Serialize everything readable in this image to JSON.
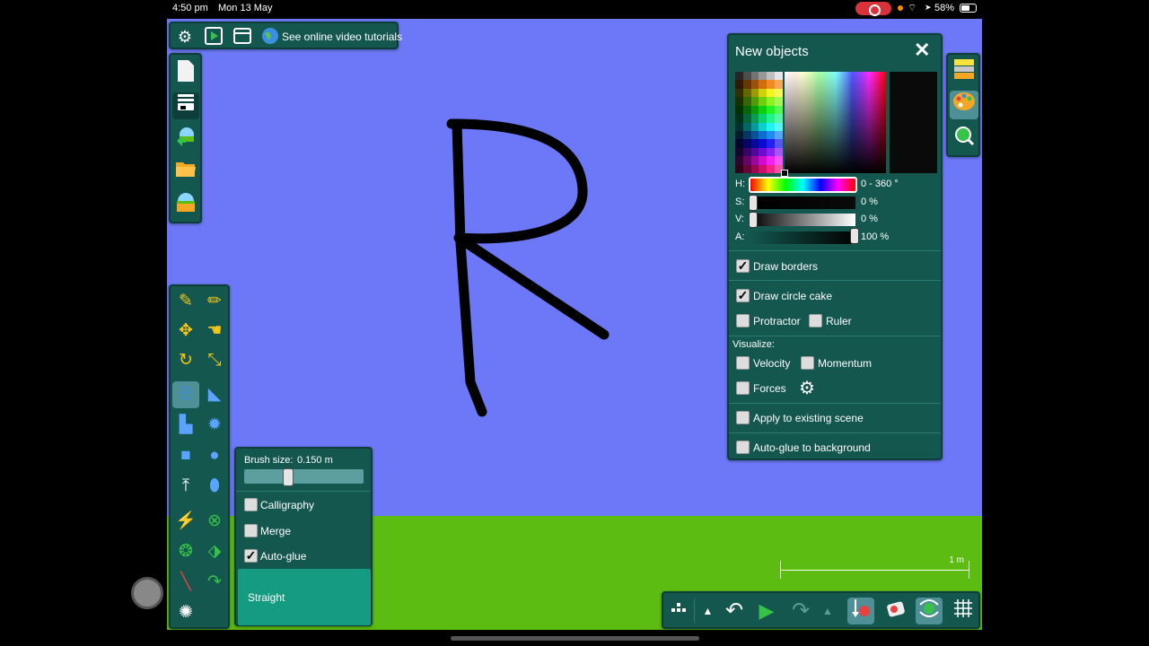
{
  "status": {
    "time": "4:50 pm",
    "date": "Mon 13 May",
    "battery": "58%"
  },
  "topbar": {
    "settings_icon": "gear-icon",
    "play_icon": "play-icon",
    "window_icon": "window-icon",
    "globe_icon": "globe-icon",
    "tutorials_label": "See online video tutorials"
  },
  "lefttop": {
    "items": [
      "new-document-icon",
      "layers-icon",
      "download-scene-icon",
      "open-folder-icon",
      "scene-browser-icon"
    ]
  },
  "lefttools": {
    "tools": [
      "sketch",
      "pencil",
      "move",
      "drag",
      "rotate",
      "scale",
      "brush",
      "knife",
      "polygon",
      "gear",
      "box",
      "circle",
      "plane",
      "chain",
      "spring",
      "fixate",
      "axle",
      "hinge",
      "laser",
      "tracer",
      "thruster",
      "spiral"
    ]
  },
  "brush": {
    "size_label": "Brush size:",
    "size_value": "0.150  m",
    "calligraphy": "Calligraphy",
    "merge": "Merge",
    "autoglue": "Auto-glue",
    "straight": "Straight"
  },
  "newobj": {
    "title": "New objects",
    "h_label": "H:",
    "h_value": "0 - 360 °",
    "s_label": "S:",
    "s_value": "0 %",
    "v_label": "V:",
    "v_value": "0 %",
    "a_label": "A:",
    "a_value": "100 %",
    "draw_borders": "Draw borders",
    "draw_circle_cake": "Draw circle cake",
    "protractor": "Protractor",
    "ruler": "Ruler",
    "visualize": "Visualize:",
    "velocity": "Velocity",
    "momentum": "Momentum",
    "forces": "Forces",
    "apply_existing": "Apply to existing scene",
    "autoglue_bg": "Auto-glue to background"
  },
  "righttabs": [
    "background-icon",
    "palette-icon",
    "zoom-icon"
  ],
  "scale": {
    "label": "1 m"
  },
  "bottom": [
    "menu-grid-icon",
    "up-arrow-icon",
    "undo-icon",
    "play-icon",
    "redo-icon",
    "up-arrow-icon",
    "gravity-icon",
    "air-friction-icon",
    "show-controller-icon",
    "grid-icon"
  ],
  "colors": {
    "scene_bg": "#6c78f7",
    "ground": "#5cbc12",
    "panel": "#13574f",
    "accent": "#159b82"
  }
}
